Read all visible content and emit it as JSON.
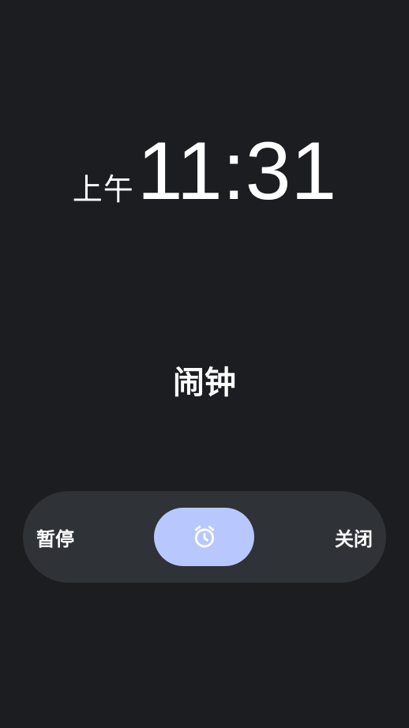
{
  "time": {
    "ampm": "上午",
    "clock": "11:31"
  },
  "alarm": {
    "label": "闹钟"
  },
  "actions": {
    "snooze_label": "暂停",
    "dismiss_label": "关闭",
    "handle_icon": "alarm-clock-icon"
  },
  "colors": {
    "background": "#1b1d20",
    "track": "#2f3237",
    "handle": "#b8c8ff",
    "text": "#ffffff"
  }
}
